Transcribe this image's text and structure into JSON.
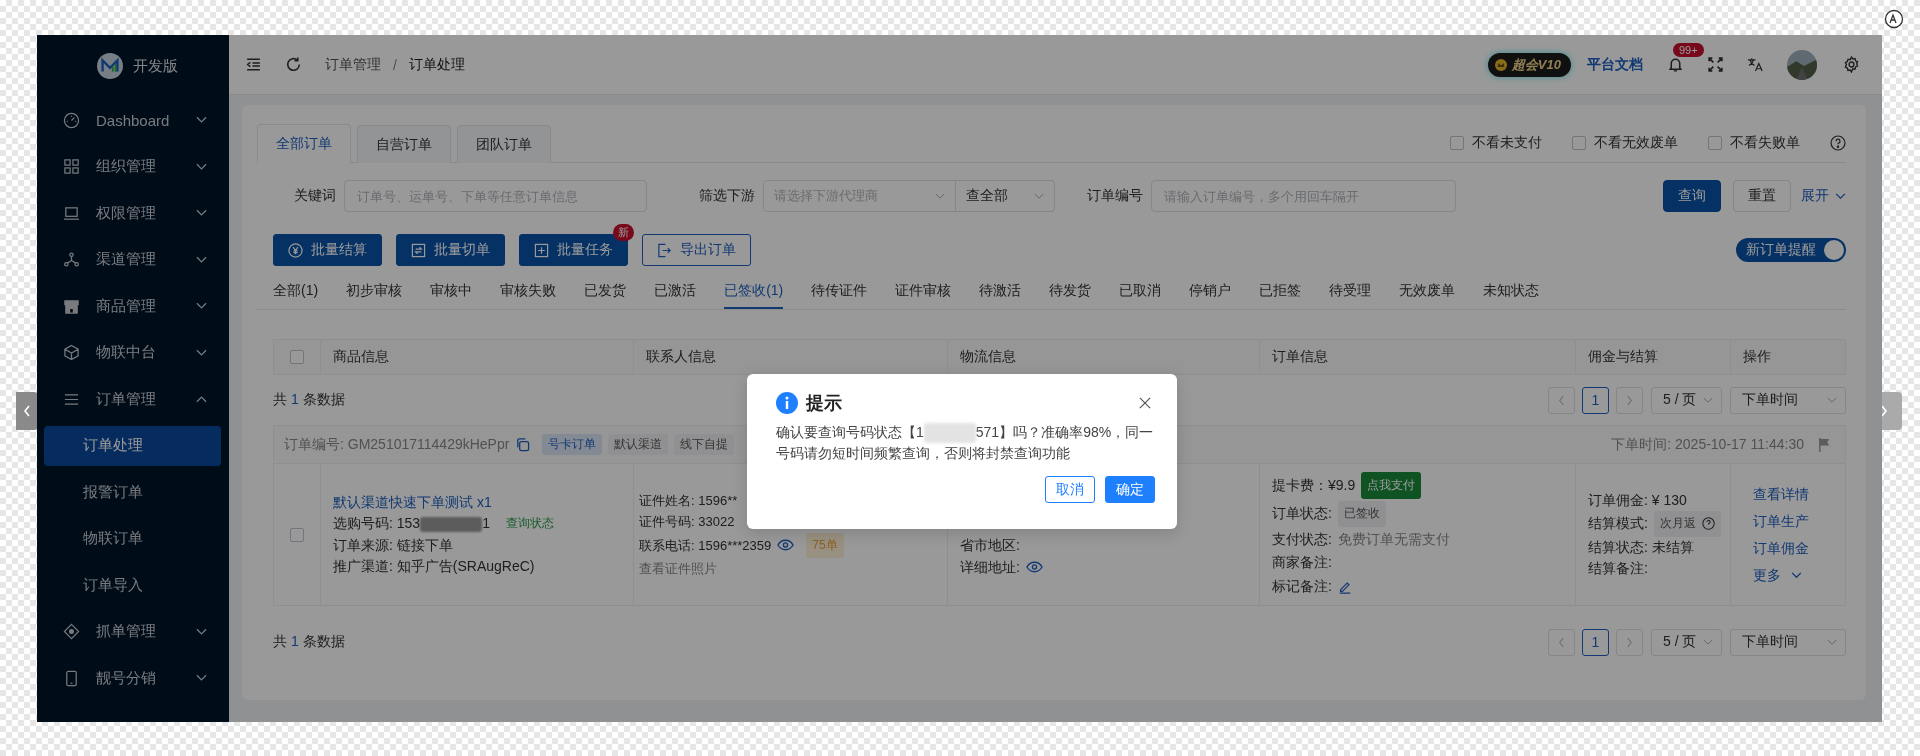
{
  "sidebar": {
    "brand": "开发版",
    "items": [
      {
        "label": "Dashboard",
        "expanded": false
      },
      {
        "label": "组织管理",
        "expanded": false
      },
      {
        "label": "权限管理",
        "expanded": false
      },
      {
        "label": "渠道管理",
        "expanded": false
      },
      {
        "label": "商品管理",
        "expanded": false
      },
      {
        "label": "物联中台",
        "expanded": false
      },
      {
        "label": "订单管理",
        "expanded": true,
        "children": [
          {
            "label": "订单处理",
            "selected": true
          },
          {
            "label": "报警订单",
            "selected": false
          },
          {
            "label": "物联订单",
            "selected": false
          },
          {
            "label": "订单导入",
            "selected": false
          }
        ]
      },
      {
        "label": "抓单管理",
        "expanded": false
      },
      {
        "label": "靓号分销",
        "expanded": false
      }
    ]
  },
  "header": {
    "breadcrumb": [
      "订单管理",
      "订单处理"
    ],
    "breadcrumb_separator": "/",
    "vip_badge": "超会V10",
    "docs_link": "平台文档",
    "notification_count": "99+"
  },
  "order_tabs": [
    {
      "label": "全部订单",
      "selected": true
    },
    {
      "label": "自营订单",
      "selected": false
    },
    {
      "label": "团队订单",
      "selected": false
    }
  ],
  "filters": [
    {
      "label": "不看未支付",
      "checked": false
    },
    {
      "label": "不看无效废单",
      "checked": false
    },
    {
      "label": "不看失败单",
      "checked": false
    }
  ],
  "search": {
    "keyword_label": "关键词",
    "keyword_placeholder": "订单号、运单号、下单等任意订单信息",
    "downstream_label": "筛选下游",
    "downstream_placeholder": "请选择下游代理商",
    "scope_value": "查全部",
    "order_no_label": "订单编号",
    "order_no_placeholder": "请输入订单编号，多个用回车隔开",
    "query_button": "查询",
    "reset_button": "重置",
    "expand_link": "展开"
  },
  "actions": [
    {
      "label": "批量结算",
      "kind": "settle"
    },
    {
      "label": "批量切单",
      "kind": "switch"
    },
    {
      "label": "批量任务",
      "kind": "task",
      "badge": "新"
    },
    {
      "label": "导出订单",
      "kind": "export"
    }
  ],
  "reminder_switch": {
    "label": "新订单提醒",
    "on": true
  },
  "status_tabs": [
    {
      "label": "全部(1)",
      "selected": false
    },
    {
      "label": "初步审核",
      "selected": false
    },
    {
      "label": "审核中",
      "selected": false
    },
    {
      "label": "审核失败",
      "selected": false
    },
    {
      "label": "已发货",
      "selected": false
    },
    {
      "label": "已激活",
      "selected": false
    },
    {
      "label": "已签收(1)",
      "selected": true
    },
    {
      "label": "待传证件",
      "selected": false
    },
    {
      "label": "证件审核",
      "selected": false
    },
    {
      "label": "待激活",
      "selected": false
    },
    {
      "label": "待发货",
      "selected": false
    },
    {
      "label": "已取消",
      "selected": false
    },
    {
      "label": "停销户",
      "selected": false
    },
    {
      "label": "已拒签",
      "selected": false
    },
    {
      "label": "待受理",
      "selected": false
    },
    {
      "label": "无效废单",
      "selected": false
    },
    {
      "label": "未知状态",
      "selected": false
    }
  ],
  "table": {
    "columns": [
      "商品信息",
      "联系人信息",
      "物流信息",
      "订单信息",
      "佣金与结算",
      "操作"
    ],
    "select_all_checked": false
  },
  "pagination_top": {
    "total_before": "共",
    "total_count": "1",
    "total_after": "条数据",
    "pages": [
      {
        "label": "1",
        "selected": true
      }
    ],
    "page_size": "5 / 页",
    "sort": "下单时间"
  },
  "order": {
    "number": "订单编号: GM251017114429kHePpr",
    "tags": [
      {
        "label": "号卡订单",
        "kind": "primary"
      },
      {
        "label": "默认渠道",
        "kind": "default"
      },
      {
        "label": "线下自提",
        "kind": "default"
      }
    ],
    "time": "下单时间: 2025-10-17 11:44:30",
    "checked": false,
    "product": {
      "title": "默认渠道快速下单测试 x1",
      "number_before": "选购号码: 153",
      "number_after": "1",
      "status_link": "查询状态",
      "source": "订单来源: 链接下单",
      "channel": "推广渠道: 知乎广告(SRAugReC)"
    },
    "contact": {
      "lines": [
        "证件姓名: 1596**",
        "证件号码: 33022"
      ],
      "phone": "联系电话: 1596***2359",
      "order_count": "75单",
      "photo_link": "查看证件照片"
    },
    "logistics": {
      "region": "省市地区:",
      "address": "详细地址:"
    },
    "info": {
      "fee": "提卡费：¥9.9",
      "pay_button": "点我支付",
      "status_label": "订单状态:",
      "status": "已签收",
      "pay_label": "支付状态:",
      "pay_status": "免费订单无需支付",
      "merchant_note": "商家备注:",
      "mark_note": "标记备注:"
    },
    "commission": {
      "amount": "订单佣金: ¥ 130",
      "mode_label": "结算模式:",
      "mode": "次月返",
      "state": "结算状态: 未结算",
      "note": "结算备注:"
    },
    "operations": [
      "查看详情",
      "订单生产",
      "订单佣金"
    ],
    "more": "更多"
  },
  "pagination_bottom": {
    "total_before": "共",
    "total_count": "1",
    "total_after": "条数据",
    "pages": [
      {
        "label": "1",
        "selected": true
      }
    ],
    "page_size": "5 / 页",
    "sort": "下单时间"
  },
  "dialog": {
    "title": "提示",
    "message_before": "确认要查询号码状态【1",
    "message_after": "571】吗？准确率98%，同一号码请勿短时间频繁查询，否则将封禁查询功能",
    "cancel": "取消",
    "confirm": "确定"
  }
}
